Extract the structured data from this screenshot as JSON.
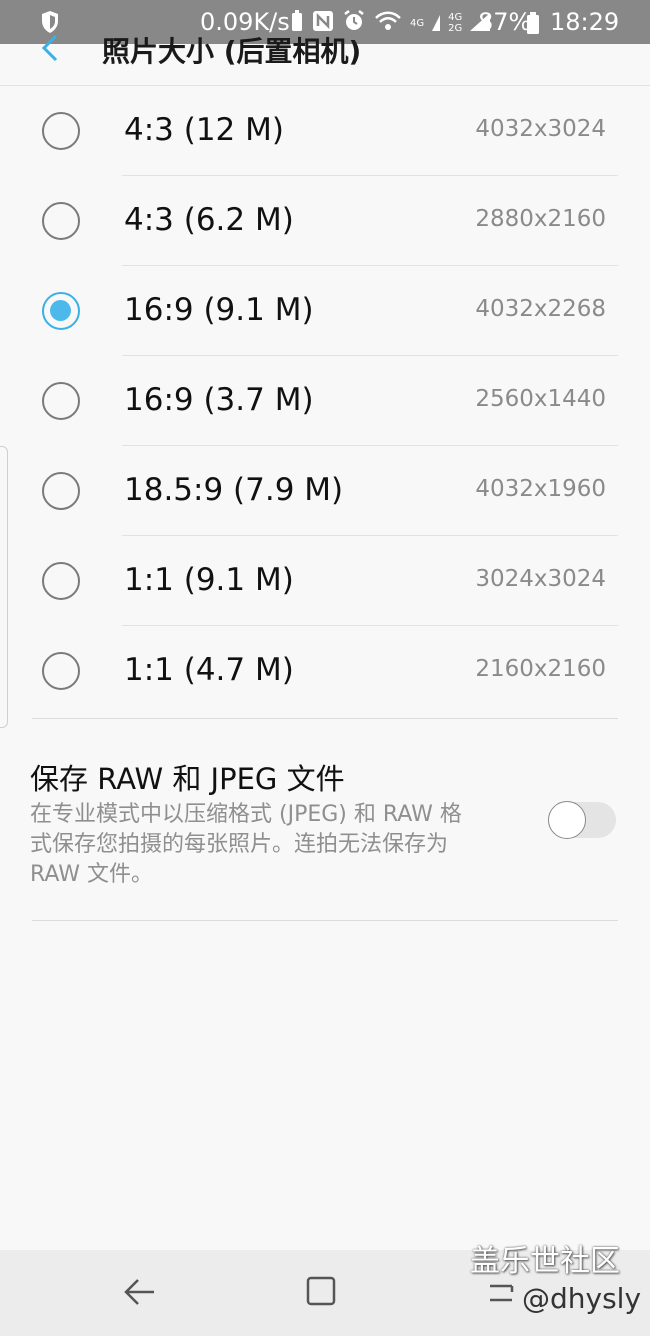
{
  "status_bar": {
    "speed": "0.09K/s",
    "signal_top": "4G",
    "signal_bottom": "2G",
    "signal2_top": "4G",
    "battery": "87%",
    "time": "18:29"
  },
  "header": {
    "title": "照片大小 (后置相机)"
  },
  "options": [
    {
      "label": "4:3 (12 M)",
      "resolution": "4032x3024",
      "selected": false
    },
    {
      "label": "4:3 (6.2 M)",
      "resolution": "2880x2160",
      "selected": false
    },
    {
      "label": "16:9 (9.1 M)",
      "resolution": "4032x2268",
      "selected": true
    },
    {
      "label": "16:9 (3.7 M)",
      "resolution": "2560x1440",
      "selected": false
    },
    {
      "label": "18.5:9 (7.9 M)",
      "resolution": "4032x1960",
      "selected": false
    },
    {
      "label": "1:1 (9.1 M)",
      "resolution": "3024x3024",
      "selected": false
    },
    {
      "label": "1:1 (4.7 M)",
      "resolution": "2160x2160",
      "selected": false
    }
  ],
  "raw_setting": {
    "title": "保存 RAW 和 JPEG 文件",
    "description_line1": "在专业模式中以压缩格式 (JPEG) 和 RAW 格",
    "description_line2": "式保存您拍摄的每张照片。连拍无法保存为",
    "description_line3": "RAW 文件。",
    "enabled": false
  },
  "watermark": {
    "site": "盖乐世社区",
    "handle": "@dhysly"
  },
  "colors": {
    "accent": "#4cb9ea",
    "status_bar": "#888888",
    "background": "#f8f8f8"
  }
}
